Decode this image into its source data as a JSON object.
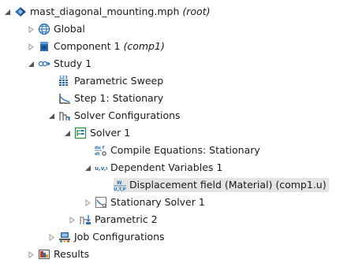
{
  "tree": {
    "root": {
      "label": "mast_diagonal_mounting.mph",
      "suffix": "(root)",
      "icon": "model-root-icon",
      "expanded": true
    },
    "global": {
      "label": "Global",
      "icon": "globe-icon",
      "expanded": false
    },
    "component": {
      "label": "Component 1",
      "suffix": "(comp1)",
      "icon": "component-icon",
      "expanded": false
    },
    "study": {
      "label": "Study 1",
      "icon": "study-icon",
      "expanded": true
    },
    "parametric_sweep": {
      "label": "Parametric Sweep",
      "icon": "parametric-sweep-icon"
    },
    "step1": {
      "label": "Step 1: Stationary",
      "icon": "stationary-step-icon"
    },
    "solver_configurations": {
      "label": "Solver Configurations",
      "icon": "solver-configurations-icon",
      "expanded": true
    },
    "solver1": {
      "label": "Solver 1",
      "icon": "solver-icon",
      "expanded": true
    },
    "compile_equations": {
      "label": "Compile Equations: Stationary",
      "icon": "compile-equations-icon"
    },
    "dependent_variables": {
      "label": "Dependent Variables 1",
      "icon": "dependent-variables-icon",
      "expanded": true
    },
    "displacement_field": {
      "label": "Displacement field (Material) (comp1.u)",
      "icon": "field-variable-icon",
      "selected": true
    },
    "stationary_solver": {
      "label": "Stationary Solver 1",
      "icon": "stationary-solver-icon",
      "expanded": false
    },
    "parametric2": {
      "label": "Parametric 2",
      "icon": "parametric-solver-icon",
      "expanded": false
    },
    "job_configurations": {
      "label": "Job Configurations",
      "icon": "job-configurations-icon",
      "expanded": false
    },
    "results": {
      "label": "Results",
      "icon": "results-icon",
      "expanded": false
    }
  },
  "colors": {
    "selection": "#e4e4e4",
    "toggle": "#555555",
    "toggle_collapsed": "#a0a0a0",
    "accent_blue": "#2a6db5"
  }
}
